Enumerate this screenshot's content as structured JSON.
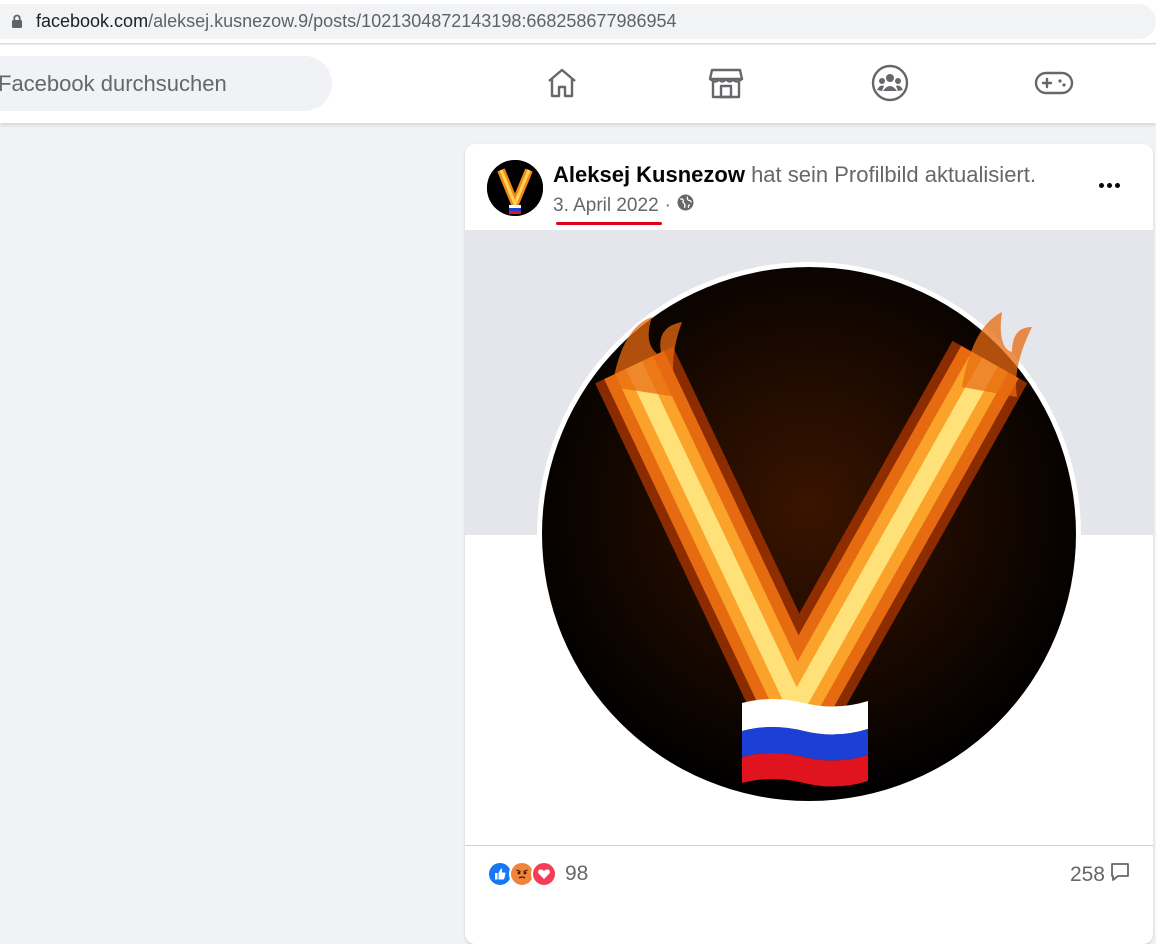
{
  "browser": {
    "url_domain": "facebook.com",
    "url_path": "/aleksej.kusnezow.9/posts/1021304872143198:668258677986954"
  },
  "topbar": {
    "search_placeholder": "Facebook durchsuchen",
    "nav_icons": [
      "home-icon",
      "marketplace-icon",
      "groups-icon",
      "gaming-icon"
    ]
  },
  "post": {
    "author": "Aleksej Kusnezow",
    "action": " hat sein Profilbild aktualisiert.",
    "date": "3. April 2022",
    "separator": "·",
    "privacy_icon": "globe-icon",
    "reactions": {
      "icons": [
        "like-icon",
        "angry-icon",
        "love-icon"
      ],
      "count": "98"
    },
    "comments_count": "258",
    "colors": {
      "highlight": "#e0001b",
      "like": "#1877f2",
      "angry": "#f0843a",
      "love": "#f33e58"
    }
  }
}
